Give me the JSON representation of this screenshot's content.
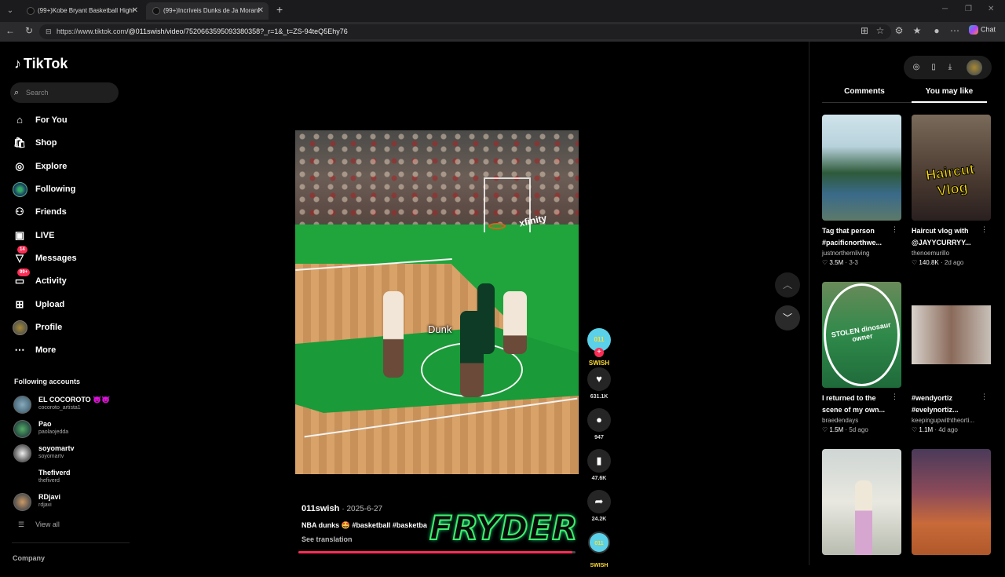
{
  "browser": {
    "tabs": [
      {
        "label": "(99+)Kobe Bryant Basketball Highl",
        "active": false
      },
      {
        "label": "(99+)Incríveis Dunks de Ja Morant",
        "active": true
      }
    ],
    "url_host": "https://www.tiktok.com",
    "url_path": "/@011swish/video/7520663595093380358?_r=1&_t=ZS-94teQ5Ehy76",
    "chat_label": "Chat"
  },
  "sidebar": {
    "logo": "TikTok",
    "search_placeholder": "Search",
    "menu": [
      {
        "label": "For You",
        "icon": "home-icon"
      },
      {
        "label": "Shop",
        "icon": "shop-icon"
      },
      {
        "label": "Explore",
        "icon": "compass-icon"
      },
      {
        "label": "Following",
        "icon": "following-avatar-icon"
      },
      {
        "label": "Friends",
        "icon": "friends-icon"
      },
      {
        "label": "LIVE",
        "icon": "live-icon"
      },
      {
        "label": "Messages",
        "icon": "messages-icon",
        "badge": "14"
      },
      {
        "label": "Activity",
        "icon": "activity-icon",
        "badge": "99+"
      },
      {
        "label": "Upload",
        "icon": "upload-icon"
      },
      {
        "label": "Profile",
        "icon": "profile-icon"
      },
      {
        "label": "More",
        "icon": "more-icon"
      }
    ],
    "following_title": "Following accounts",
    "accounts": [
      {
        "name": "EL COCOROTO 😈😈",
        "handle": "cocoroto_artista1"
      },
      {
        "name": "Pao",
        "handle": "paolaojedda"
      },
      {
        "name": "soyomartv",
        "handle": "soyomartv"
      },
      {
        "name": "Thefiverd",
        "handle": "thefiverd"
      },
      {
        "name": "RDjavi",
        "handle": "rdjavi"
      }
    ],
    "view_all": "View all",
    "company": "Company"
  },
  "video": {
    "overlay_text": "Dunk",
    "arena_banner": "xfinity",
    "author": "011swish",
    "date": "· 2025-6-27",
    "description": "NBA dunks 🤩 #basketball #basketba",
    "see_translation": "See translation",
    "watermark": "FRYDER",
    "progress": 0.99,
    "creator_badge": "011 SWISH",
    "likes": "631.1K",
    "comments": "947",
    "saves": "47.6K",
    "shares": "24.2K"
  },
  "right_panel": {
    "tabs": [
      "Comments",
      "You may like"
    ],
    "active_tab": "You may like",
    "cards": [
      {
        "title": "Tag that person\n#pacificnorthwe...",
        "author": "justnorthernliving",
        "likes": "3.5M",
        "age": "3-3",
        "thumb_text": ""
      },
      {
        "title": "Haircut vlog with\n@JAYYCURRYY...",
        "author": "thenoemurillo",
        "likes": "140.8K",
        "age": "2d ago",
        "thumb_text": "Haircut\nVlog"
      },
      {
        "title": "I returned to the\nscene of my own...",
        "author": "braedendays",
        "likes": "1.5M",
        "age": "5d ago",
        "thumb_text": "STOLEN dinosaur owner"
      },
      {
        "title": "#wendyortiz\n#evelynortiz...",
        "author": "keepingupwiththeorti...",
        "likes": "1.1M",
        "age": "4d ago",
        "thumb_text": ""
      },
      {
        "title": "",
        "author": "",
        "likes": "",
        "age": "",
        "thumb_text": ""
      },
      {
        "title": "",
        "author": "",
        "likes": "",
        "age": "",
        "thumb_text": ""
      }
    ]
  },
  "colors": {
    "accent": "#fe2c55",
    "green_watermark": "#3df06a",
    "court_green": "#1fa53c"
  }
}
